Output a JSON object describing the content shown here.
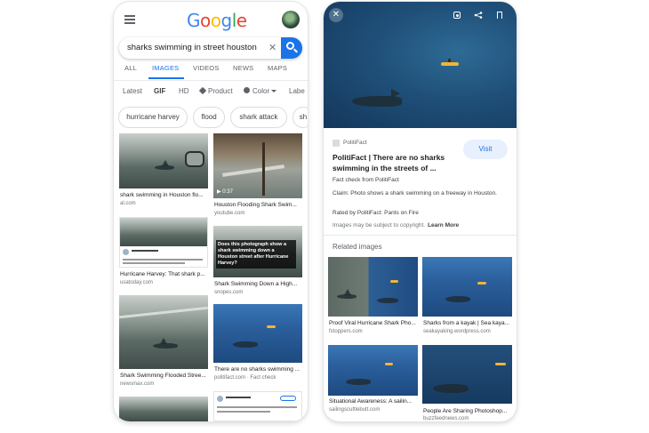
{
  "search": {
    "query": "sharks swimming in street houston"
  },
  "tabs": [
    {
      "label": "ALL"
    },
    {
      "label": "IMAGES"
    },
    {
      "label": "VIDEOS"
    },
    {
      "label": "NEWS"
    },
    {
      "label": "MAPS"
    }
  ],
  "filters": [
    "Latest",
    "GIF",
    "HD",
    "Product",
    "Color",
    "Labe"
  ],
  "chips": [
    "hurricane harvey",
    "flood",
    "shark attack",
    "sh"
  ],
  "results_left": [
    {
      "caption": "shark swimming in Houston flo...",
      "source": "al.com"
    },
    {
      "caption": "Houston Flooding Shark Swim...",
      "source": "youtube.com",
      "badge": "0:37"
    },
    {
      "caption": "Hurricane Harvey: That shark p...",
      "source": "usatoday.com"
    },
    {
      "caption": "Shark Swimming Down a High...",
      "source": "snopes.com",
      "overlay": "Does this photograph show a shark swimming down a Houston street after Hurricane Harvey?"
    },
    {
      "caption": "Shark Swimming Flooded Stree...",
      "source": "newsmax.com"
    },
    {
      "caption": "There are no sharks swimming ...",
      "source": "politifact.com · Fact check"
    }
  ],
  "detail": {
    "source_name": "PolitiFact",
    "title": "PolitiFact | There are no sharks swimming in the streets of ...",
    "visit_label": "Visit",
    "fact_check": "Fact check from PolitiFact",
    "claim": "Claim: Photo shows a shark swimming on a freeway in Houston.",
    "rated": "Rated by PolitiFact: Pants on Fire",
    "copyright": "Images may be subject to copyright.",
    "learn_more": "Learn More",
    "related_title": "Related images"
  },
  "related": [
    {
      "caption": "Proof Viral Hurricane Shark Pho...",
      "source": "fstoppers.com"
    },
    {
      "caption": "Sharks from a kayak | Sea kaya...",
      "source": "seakayaking.wordpress.com"
    },
    {
      "caption": "Situational Awareness: A sailin...",
      "source": "sailingscuttlebutt.com"
    },
    {
      "caption": "People Are Sharing Photoshop...",
      "source": "buzzfeednews.com"
    }
  ],
  "colors": {
    "accent": "#1a73e8",
    "visit_bg": "#e8f0fe"
  }
}
